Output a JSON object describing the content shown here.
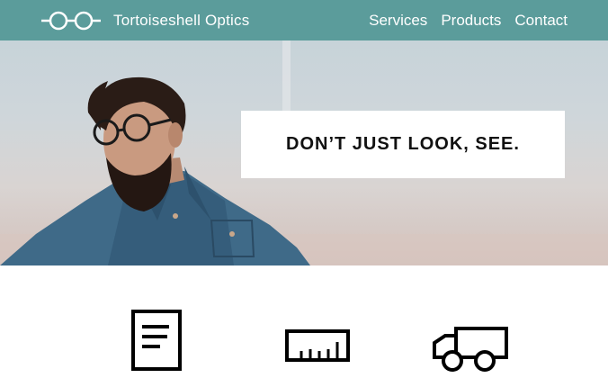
{
  "nav": {
    "logo_icon": "glasses-icon",
    "brand": "Tortoiseshell Optics",
    "items": [
      {
        "label": "Services"
      },
      {
        "label": "Products"
      },
      {
        "label": "Contact"
      }
    ]
  },
  "hero": {
    "tagline": "DON’T JUST LOOK, SEE.",
    "image_subject": "man-with-glasses-photo"
  },
  "features": {
    "icons": [
      "document-icon",
      "ruler-icon",
      "delivery-truck-icon"
    ]
  },
  "colors": {
    "nav_background": "#5b9c9b",
    "text_on_nav": "#ffffff",
    "tagline_box": "#ffffff",
    "icon_stroke": "#000000"
  }
}
